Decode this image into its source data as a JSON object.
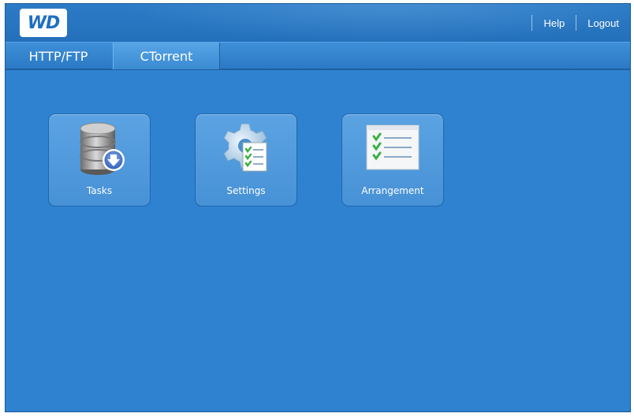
{
  "header": {
    "logo_text": "WD",
    "links": [
      {
        "label": "Help"
      },
      {
        "label": "Logout"
      }
    ]
  },
  "tabs": [
    {
      "label": "HTTP/FTP",
      "active": false
    },
    {
      "label": "CTorrent",
      "active": true
    }
  ],
  "tiles": [
    {
      "label": "Tasks",
      "icon": "database-download-icon"
    },
    {
      "label": "Settings",
      "icon": "gear-checklist-icon"
    },
    {
      "label": "Arrangement",
      "icon": "checklist-icon"
    }
  ],
  "colors": {
    "background": "#2f82cf",
    "tile": "#4f97da",
    "text": "#ffffff",
    "check": "#3cb043"
  }
}
